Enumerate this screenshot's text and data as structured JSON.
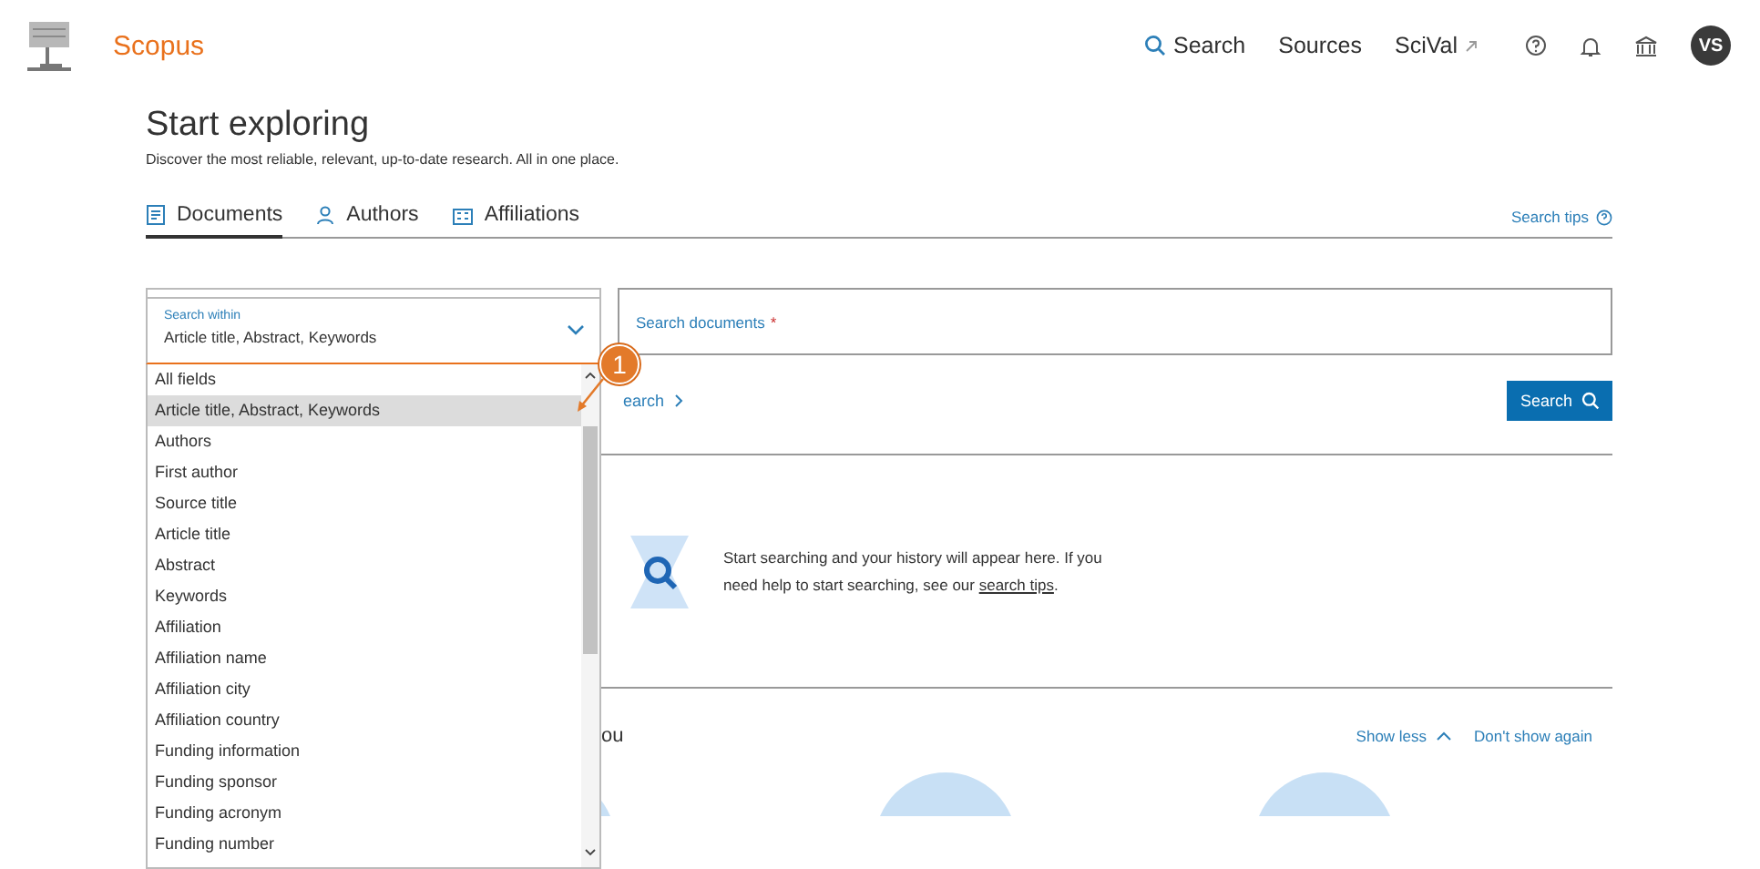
{
  "header": {
    "brand": "Scopus",
    "nav": [
      {
        "kind": "search",
        "label": "Search"
      },
      {
        "kind": "plain",
        "label": "Sources"
      },
      {
        "kind": "external",
        "label": "SciVal"
      }
    ],
    "avatar": "VS"
  },
  "intro": {
    "title": "Start exploring",
    "subtitle": "Discover the most reliable, relevant, up-to-date research. All in one place."
  },
  "tabs": [
    {
      "kind": "documents",
      "label": "Documents",
      "selected": true
    },
    {
      "kind": "authors",
      "label": "Authors",
      "selected": false
    },
    {
      "kind": "affiliations",
      "label": "Affiliations",
      "selected": false
    }
  ],
  "search_tips": "Search tips",
  "search_within": {
    "label": "Search within",
    "value": "Article title, Abstract, Keywords"
  },
  "search_field": {
    "placeholder": "Search documents",
    "required_mark": "*"
  },
  "advanced_link": "earch",
  "search_button": "Search",
  "dropdown": {
    "items": [
      {
        "label": "All fields",
        "selected": false
      },
      {
        "label": "Article title, Abstract, Keywords",
        "selected": true
      },
      {
        "label": "Authors",
        "selected": false
      },
      {
        "label": "First author",
        "selected": false
      },
      {
        "label": "Source title",
        "selected": false
      },
      {
        "label": "Article title",
        "selected": false
      },
      {
        "label": "Abstract",
        "selected": false
      },
      {
        "label": "Keywords",
        "selected": false
      },
      {
        "label": "Affiliation",
        "selected": false
      },
      {
        "label": "Affiliation name",
        "selected": false
      },
      {
        "label": "Affiliation city",
        "selected": false
      },
      {
        "label": "Affiliation country",
        "selected": false
      },
      {
        "label": "Funding information",
        "selected": false
      },
      {
        "label": "Funding sponsor",
        "selected": false
      },
      {
        "label": "Funding acronym",
        "selected": false
      },
      {
        "label": "Funding number",
        "selected": false
      }
    ]
  },
  "annotation": {
    "label": "1"
  },
  "history": {
    "text": "Start searching and your history will appear here. If you need help to start searching, see our ",
    "link": "search tips",
    "end": "."
  },
  "section": {
    "title": "ou",
    "show_less": "Show less",
    "dont_show": "Don't show again"
  }
}
